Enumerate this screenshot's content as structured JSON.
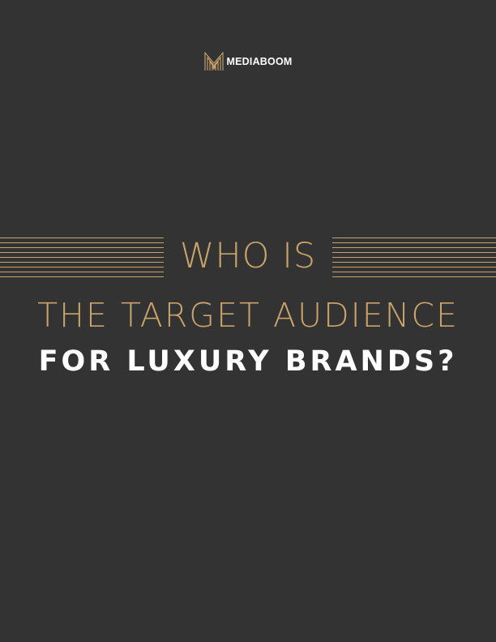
{
  "brand": {
    "name": "MEDIABOOM",
    "logo_icon": "m-logo-icon"
  },
  "title": {
    "line1": "WHO IS",
    "line2": "THE TARGET AUDIENCE",
    "line3": "FOR LUXURY BRANDS?"
  },
  "colors": {
    "background": "#333333",
    "gold": "#c9a46a",
    "white": "#ffffff"
  }
}
